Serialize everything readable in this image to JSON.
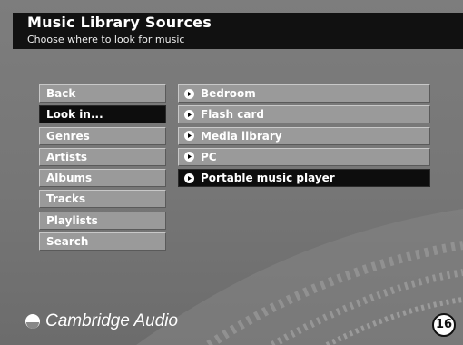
{
  "header": {
    "title": "Music Library Sources",
    "subtitle": "Choose where to look for music"
  },
  "menu": {
    "items": [
      {
        "label": "Back",
        "selected": false
      },
      {
        "label": "Look in...",
        "selected": true
      },
      {
        "label": "Genres",
        "selected": false
      },
      {
        "label": "Artists",
        "selected": false
      },
      {
        "label": "Albums",
        "selected": false
      },
      {
        "label": "Tracks",
        "selected": false
      },
      {
        "label": "Playlists",
        "selected": false
      },
      {
        "label": "Search",
        "selected": false
      }
    ]
  },
  "sources": {
    "icon": "play-circle-icon",
    "items": [
      {
        "label": "Bedroom",
        "selected": false
      },
      {
        "label": "Flash card",
        "selected": false
      },
      {
        "label": "Media library",
        "selected": false
      },
      {
        "label": "PC",
        "selected": false
      },
      {
        "label": "Portable music player",
        "selected": true
      }
    ]
  },
  "brand": {
    "name": "Cambridge Audio"
  },
  "page_number": "16",
  "colors": {
    "background": "#777777",
    "button": "#9a9a9a",
    "selected": "#0d0d0d",
    "text": "#ffffff"
  }
}
